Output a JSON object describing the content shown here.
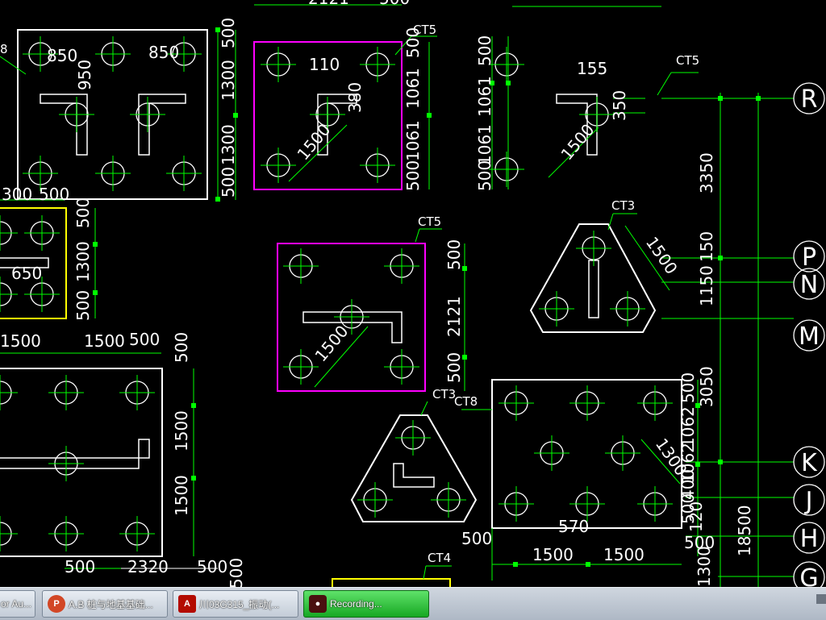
{
  "taskbar": {
    "items": [
      {
        "label": "or Au...",
        "icon": "cad-app-icon",
        "active": false
      },
      {
        "label": "A.B 桩与地基基础...",
        "icon": "powerpoint-icon",
        "active": false
      },
      {
        "label": "川03G315_振动(...",
        "icon": "pdf-icon",
        "active": false
      },
      {
        "label": "Recording...",
        "icon": "video-camera-icon",
        "active": true
      }
    ]
  },
  "drawing": {
    "colors": {
      "background": "#000000",
      "dimension": "#00ff00",
      "outline": "#ffffff",
      "cap_magenta": "#ff00ff",
      "cap_yellow": "#ffff00"
    },
    "cap_labels": [
      "CT5",
      "CT5",
      "CT5",
      "CT3",
      "CT3",
      "CT8",
      "CT4",
      "8"
    ],
    "grid_axes": [
      "R",
      "P",
      "N",
      "M",
      "K",
      "J",
      "H",
      "G"
    ],
    "dimensions": [
      "2121",
      "500",
      "850",
      "850",
      "950",
      "110",
      "380",
      "1500",
      "500",
      "1300",
      "1300",
      "500",
      "500",
      "1061",
      "1061",
      "500",
      "155",
      "350",
      "1500",
      "500",
      "1061",
      "1061",
      "500",
      "300",
      "500",
      "650",
      "500",
      "1300",
      "500",
      "1500",
      "1500",
      "500",
      "500",
      "1500",
      "1500",
      "500",
      "2121",
      "500",
      "1500",
      "1500",
      "3350",
      "150",
      "1150",
      "3050",
      "500",
      "1062",
      "1300",
      "1062",
      "400",
      "500",
      "120",
      "570",
      "500",
      "1500",
      "1500",
      "500",
      "18500",
      "1300",
      "500",
      "2320",
      "500",
      "500"
    ]
  }
}
